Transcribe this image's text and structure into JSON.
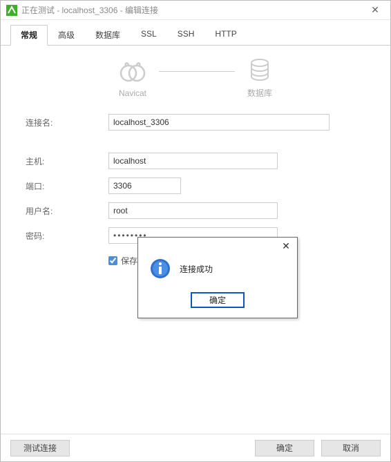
{
  "window": {
    "title": "正在测试 - localhost_3306 - 编辑连接",
    "close_glyph": "✕"
  },
  "tabs": {
    "t0": "常规",
    "t1": "高级",
    "t2": "数据库",
    "t3": "SSL",
    "t4": "SSH",
    "t5": "HTTP"
  },
  "diagram": {
    "left": "Navicat",
    "right": "数据库"
  },
  "form": {
    "conn_name_label": "连接名:",
    "conn_name_value": "localhost_3306",
    "host_label": "主机:",
    "host_value": "localhost",
    "port_label": "端口:",
    "port_value": "3306",
    "user_label": "用户名:",
    "user_value": "root",
    "pwd_label": "密码:",
    "pwd_value": "••••••••",
    "save_pwd_label": "保存密码"
  },
  "footer": {
    "test_label": "测试连接",
    "ok_label": "确定",
    "cancel_label": "取消"
  },
  "dialog": {
    "message": "连接成功",
    "ok_label": "确定",
    "close_glyph": "✕"
  }
}
